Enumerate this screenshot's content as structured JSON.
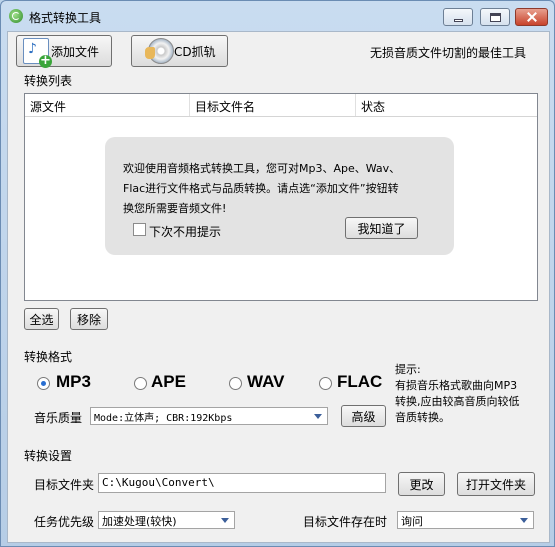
{
  "window": {
    "title": "格式转换工具"
  },
  "toolbar": {
    "add_file_label": "添加文件",
    "cd_rip_label": "CD抓轨",
    "tagline": "无损音质文件切割的最佳工具"
  },
  "file_list": {
    "section_label": "转换列表",
    "columns": [
      "源文件",
      "目标文件名",
      "状态"
    ],
    "tip": {
      "lines": [
        "欢迎使用音频格式转换工具，您可对Mp3、Ape、Wav、",
        "Flac进行文件格式与品质转换。请点选“添加文件”按钮转",
        "换您所需要音频文件!"
      ],
      "dont_show_label": "下次不用提示",
      "dont_show_checked": false,
      "ok_label": "我知道了"
    },
    "select_all_label": "全选",
    "remove_label": "移除"
  },
  "format": {
    "section_label": "转换格式",
    "options": [
      "MP3",
      "APE",
      "WAV",
      "FLAC"
    ],
    "selected": "MP3",
    "quality_label": "音乐质量",
    "quality_value": "Mode:立体声; CBR:192Kbps",
    "advanced_label": "高级",
    "hint_lines": [
      "提示:",
      "  有损音乐格式歌曲向MP3",
      "转换,应由较高音质向较低",
      "音质转换。"
    ]
  },
  "settings": {
    "section_label": "转换设置",
    "target_folder_label": "目标文件夹",
    "target_folder_value": "C:\\Kugou\\Convert\\",
    "change_label": "更改",
    "open_folder_label": "打开文件夹",
    "priority_label": "任务优先级",
    "priority_value": "加速处理(较快)",
    "exists_label": "目标文件存在时",
    "exists_value": "询问"
  },
  "colors": {
    "radio_selected": "#2a6fd1",
    "combo_arrow": "#3c5f9a",
    "window_frame": "#b6cde6"
  }
}
